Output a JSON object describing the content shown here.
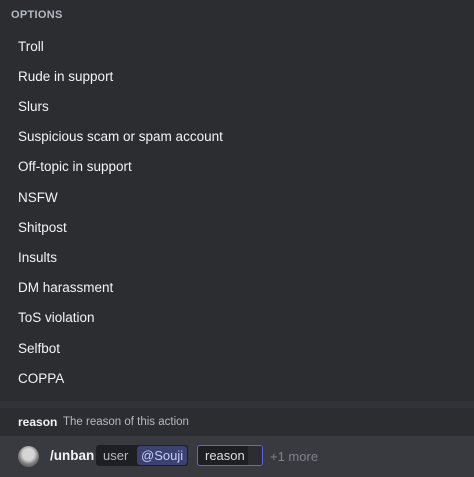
{
  "options_panel": {
    "header": "OPTIONS",
    "items": [
      "Troll",
      "Rude in support",
      "Slurs",
      "Suspicious scam or spam account",
      "Off-topic in support",
      "NSFW",
      "Shitpost",
      "Insults",
      "DM harassment",
      "ToS violation",
      "Selfbot",
      "COPPA"
    ]
  },
  "param_hint": {
    "name": "reason",
    "description": "The reason of this action"
  },
  "command_bar": {
    "avatar_icon": "user-avatar",
    "command": "/unban",
    "user_param": {
      "label": "user",
      "value": "@Souji"
    },
    "reason_param": {
      "label": "reason"
    },
    "more": "+1 more"
  },
  "colors": {
    "accent": "#5865f2",
    "mention_bg": "#3c4270",
    "panel_bg": "#2b2d31"
  }
}
